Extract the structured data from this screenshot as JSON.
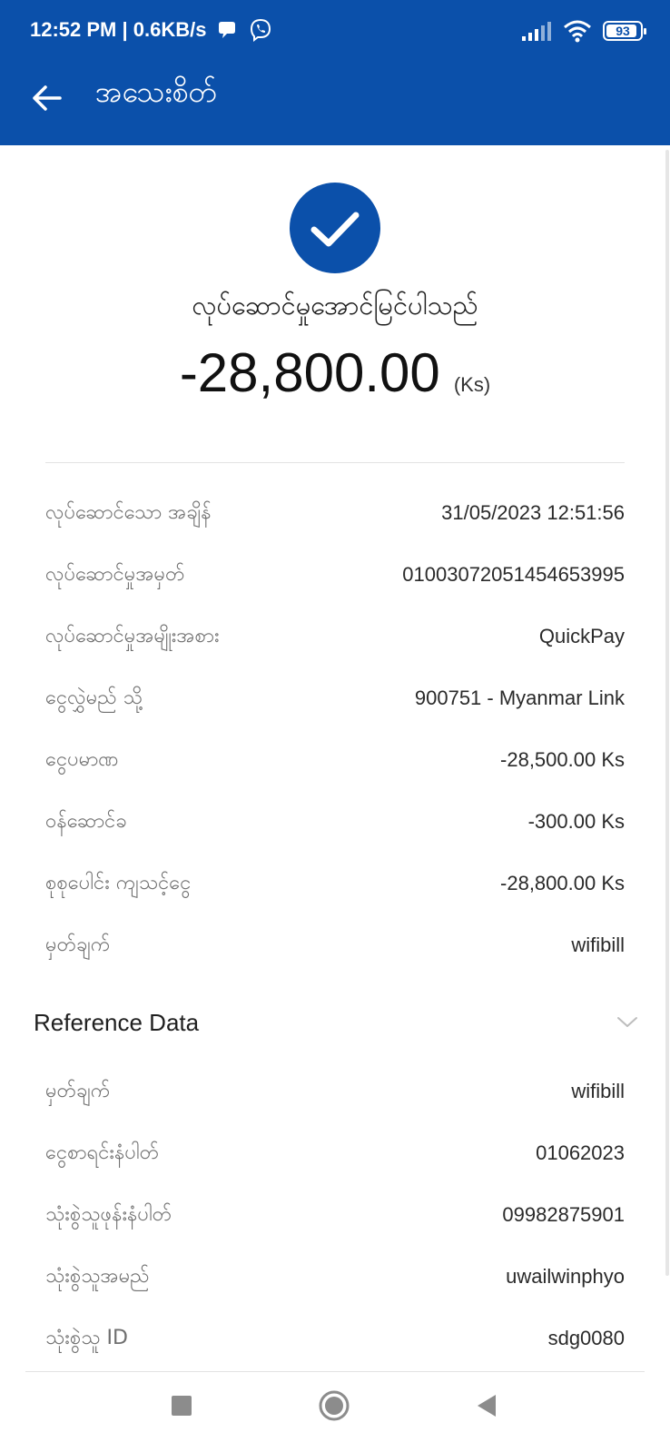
{
  "status_bar": {
    "time": "12:52 PM | 0.6KB/s",
    "battery": "93",
    "battery_level": 0.93
  },
  "header": {
    "title": "အသေးစိတ်"
  },
  "result": {
    "message": "လုပ်ဆောင်မှုအောင်မြင်ပါသည်",
    "amount": "-28,800.00",
    "currency": "(Ks)"
  },
  "details": [
    {
      "label": "လုပ်ဆောင်သော အချိန်",
      "value": "31/05/2023 12:51:56"
    },
    {
      "label": "လုပ်ဆောင်မှုအမှတ်",
      "value": "01003072051454653995"
    },
    {
      "label": "လုပ်ဆောင်မှုအမျိုးအစား",
      "value": "QuickPay"
    },
    {
      "label": "ငွေလွှဲမည် သို့",
      "value": "900751 - Myanmar Link"
    },
    {
      "label": "ငွေပမာဏ",
      "value": "-28,500.00 Ks"
    },
    {
      "label": "ဝန်ဆောင်ခ",
      "value": "-300.00 Ks"
    },
    {
      "label": "စုစုပေါင်း ကျသင့်ငွေ",
      "value": "-28,800.00 Ks"
    },
    {
      "label": "မှတ်ချက်",
      "value": "wifibill"
    }
  ],
  "reference": {
    "title": "Reference Data",
    "items": [
      {
        "label": "မှတ်ချက်",
        "value": "wifibill"
      },
      {
        "label": "ငွေစာရင်းနံပါတ်",
        "value": "01062023"
      },
      {
        "label": "သုံးစွဲသူဖုန်းနံပါတ်",
        "value": "09982875901"
      },
      {
        "label": "သုံးစွဲသူအမည်",
        "value": "uwailwinphyo"
      },
      {
        "label": "သုံးစွဲသူ ID",
        "value": "sdg0080"
      }
    ]
  },
  "icons": {
    "back": "arrow-left-icon",
    "success": "check-icon",
    "expand": "chevron-down-icon",
    "nav_recents": "square-icon",
    "nav_home": "circle-icon",
    "nav_back": "triangle-back-icon"
  },
  "colors": {
    "brand": "#0b50aa",
    "label": "#6f6f6f",
    "value": "#2a2a2a"
  }
}
